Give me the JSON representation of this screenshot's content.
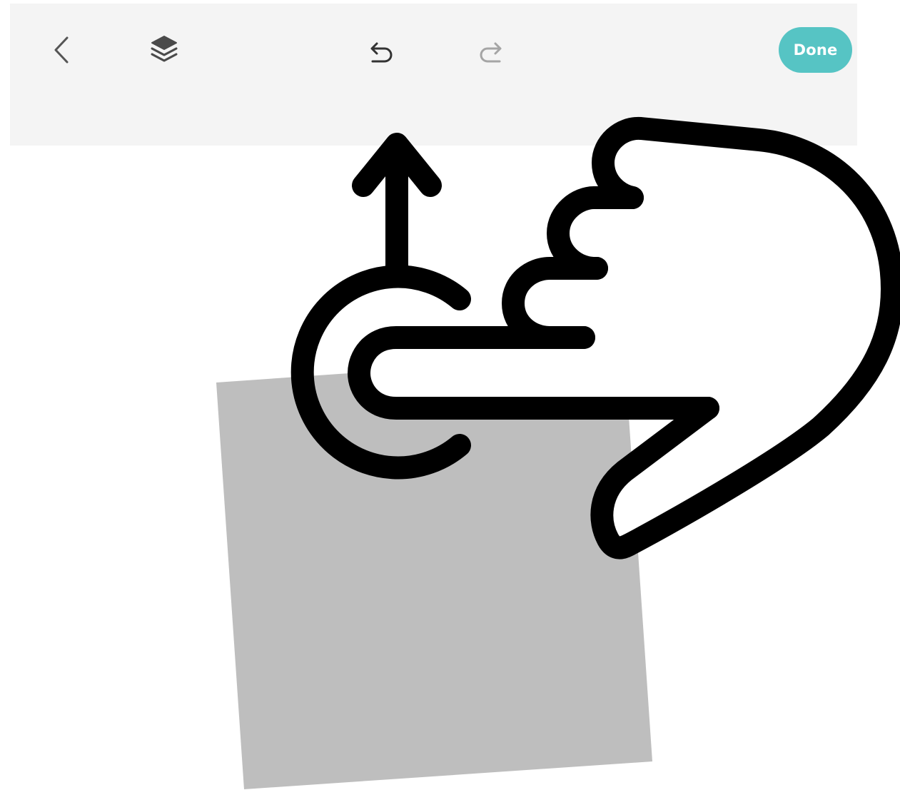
{
  "toolbar": {
    "back_icon": "chevron-left-icon",
    "layers_icon": "layers-icon",
    "undo_icon": "undo-icon",
    "redo_icon": "redo-icon",
    "done_label": "Done",
    "done_color": "#56c4c4",
    "background_color": "#f4f4f4"
  },
  "canvas": {
    "shape_color": "#bebebe",
    "shape_kind": "rotated-square"
  },
  "gesture_hint": {
    "icon": "hand-swipe-up-icon",
    "direction": "up"
  }
}
